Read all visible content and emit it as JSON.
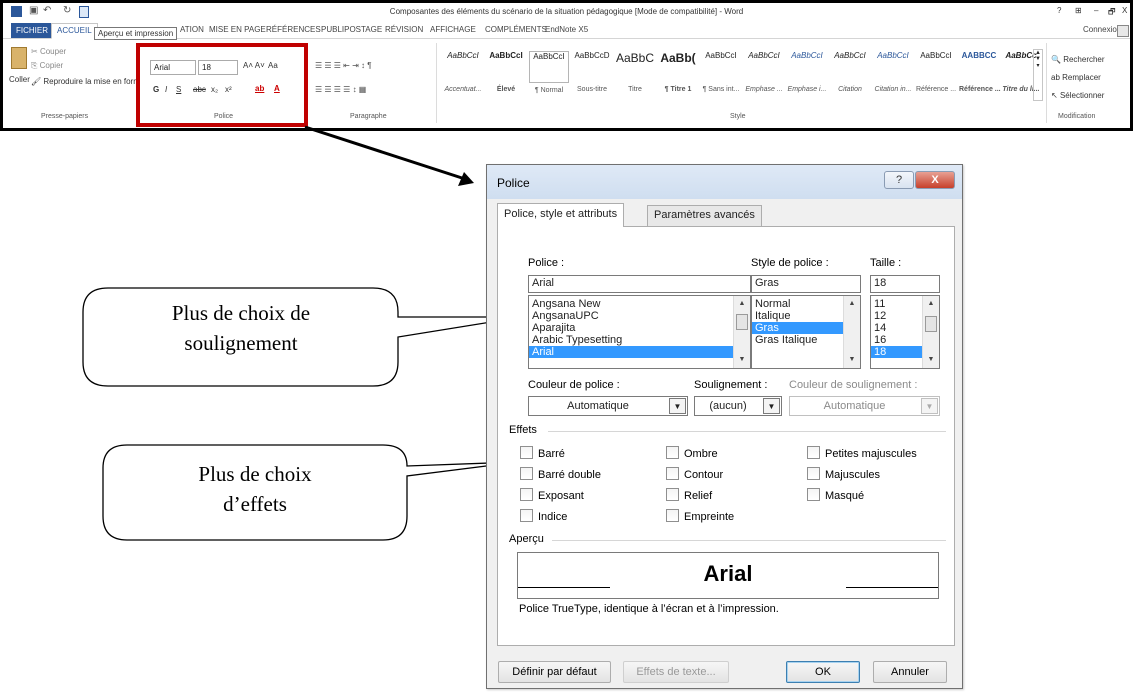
{
  "window": {
    "title": "Composantes des éléments du scénario de la situation pédagogique [Mode de compatibilité] - Word",
    "controls": [
      "?",
      "⊞",
      "–",
      "🗗",
      "X"
    ],
    "account": "Connexion"
  },
  "ribbon": {
    "tabs": [
      "FICHIER",
      "ACCUEIL",
      "MISE EN PAGE",
      "RÉFÉRENCES",
      "PUBLIPOSTAGE",
      "RÉVISION",
      "AFFICHAGE",
      "COMPLÉMENTS",
      "EndNote X5"
    ],
    "tooltip": "Aperçu et impression",
    "tab_partial": "ATION",
    "clipboard": {
      "cut": "Couper",
      "copy": "Copier",
      "paste": "Coller",
      "format_painter": "Reproduire la mise en form",
      "group_label": "Presse-papiers"
    },
    "font": {
      "font_name": "Arial",
      "font_size": "18",
      "bold": "G",
      "italic": "I",
      "underline": "S",
      "strike": "abc",
      "subscript": "x₂",
      "superscript": "x²",
      "case": "Aa",
      "group_label": "Police"
    },
    "paragraph": {
      "group_label": "Paragraphe"
    },
    "styles": {
      "items": [
        {
          "preview": "AaBbCcI",
          "label": "Accentuat..."
        },
        {
          "preview": "AaBbCcI",
          "label": "Élevé"
        },
        {
          "preview": "AaBbCcI",
          "label": "¶ Normal"
        },
        {
          "preview": "AaBbCcD",
          "label": "Sous-titre"
        },
        {
          "preview": "AaBbC",
          "label": "Titre"
        },
        {
          "preview": "AaBb(",
          "label": "¶ Titre 1"
        },
        {
          "preview": "AaBbCcI",
          "label": "¶ Sans int..."
        },
        {
          "preview": "AaBbCcI",
          "label": "Emphase ..."
        },
        {
          "preview": "AaBbCcI",
          "label": "Emphase i..."
        },
        {
          "preview": "AaBbCcI",
          "label": "Citation"
        },
        {
          "preview": "AaBbCcI",
          "label": "Citation in..."
        },
        {
          "preview": "AaBbCcI",
          "label": "Référence ..."
        },
        {
          "preview": "AABBCC",
          "label": "Référence ..."
        },
        {
          "preview": "AaBbCc",
          "label": "Titre du li..."
        }
      ],
      "group_label": "Style"
    },
    "editing": {
      "find": "Rechercher",
      "replace": "Remplacer",
      "select": "Sélectionner",
      "group_label": "Modification"
    }
  },
  "dialog": {
    "title": "Police",
    "help": "?",
    "close": "X",
    "tabs": [
      "Police, style et attributs",
      "Paramètres avancés"
    ],
    "font_label": "Police :",
    "font_value": "Arial",
    "font_list": [
      "Angsana New",
      "AngsanaUPC",
      "Aparajita",
      "Arabic Typesetting",
      "Arial"
    ],
    "style_label": "Style de police :",
    "style_value": "Gras",
    "style_list": [
      "Normal",
      "Italique",
      "Gras",
      "Gras Italique"
    ],
    "size_label": "Taille :",
    "size_value": "18",
    "size_list": [
      "11",
      "12",
      "14",
      "16",
      "18"
    ],
    "color_label": "Couleur de police :",
    "color_value": "Automatique",
    "underline_label": "Soulignement :",
    "underline_value": "(aucun)",
    "underline_color_label": "Couleur de soulignement :",
    "underline_color_value": "Automatique",
    "effects_label": "Effets",
    "effects": {
      "col1": [
        "Barré",
        "Barré double",
        "Exposant",
        "Indice"
      ],
      "col2": [
        "Ombre",
        "Contour",
        "Relief",
        "Empreinte"
      ],
      "col3": [
        "Petites majuscules",
        "Majuscules",
        "Masqué"
      ]
    },
    "preview_label": "Aperçu",
    "preview_text": "Arial",
    "preview_note": "Police TrueType, identique à l’écran et à l’impression.",
    "buttons": {
      "default": "Définir par défaut",
      "text_effects": "Effets de texte...",
      "ok": "OK",
      "cancel": "Annuler"
    }
  },
  "callouts": {
    "underline": [
      "Plus de choix de",
      "soulignement"
    ],
    "effects": [
      "Plus de choix",
      "d’effets"
    ]
  },
  "colors": {
    "highlight": "#c00000",
    "file_tab": "#2b579a",
    "selection": "#3399ff"
  }
}
